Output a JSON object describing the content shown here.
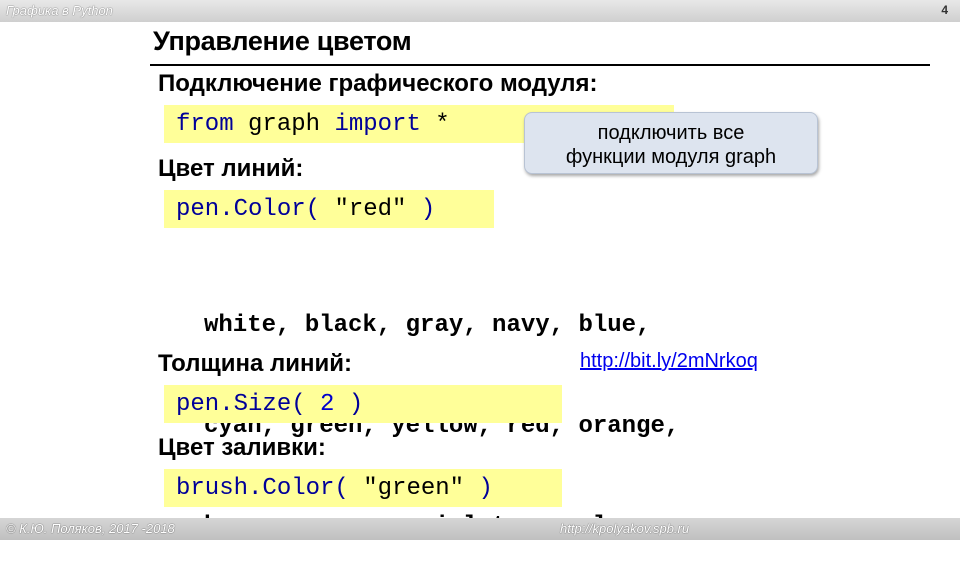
{
  "header": {
    "course": "Графика в Python",
    "page_number": "4"
  },
  "slide": {
    "title": "Управление цветом",
    "section_import": {
      "heading": "Подключение графического модуля:",
      "code_from": "from",
      "code_module": "graph",
      "code_import": "import",
      "code_star": "*"
    },
    "callout": {
      "line1": "подключить все",
      "line2": "функции модуля graph"
    },
    "section_pen_color": {
      "heading": "Цвет линий:",
      "code_func": "pen.Color(",
      "code_arg": "\"red\"",
      "code_close": ")"
    },
    "color_names": {
      "line1": "white, black, gray, navy, blue,",
      "line2": "cyan, green, yellow, red, orange,",
      "line3": "brown, maroon, violet, purple, ..."
    },
    "link": "http://bit.ly/2mNrkoq",
    "section_pen_size": {
      "heading": "Толщина линий:",
      "code_func": "pen.Size(",
      "code_arg": "2",
      "code_close": ")"
    },
    "section_brush_color": {
      "heading": "Цвет заливки:",
      "code_func": "brush.Color(",
      "code_arg": "\"green\"",
      "code_close": ")"
    }
  },
  "footer": {
    "copyright": "© К.Ю. Поляков, 2017 -2018",
    "site": "http://kpolyakov.spb.ru"
  },
  "colors": {
    "code_background": "#ffff99",
    "keyword": "#000099",
    "callout_background": "#dde4ef",
    "link": "#0000ee"
  }
}
